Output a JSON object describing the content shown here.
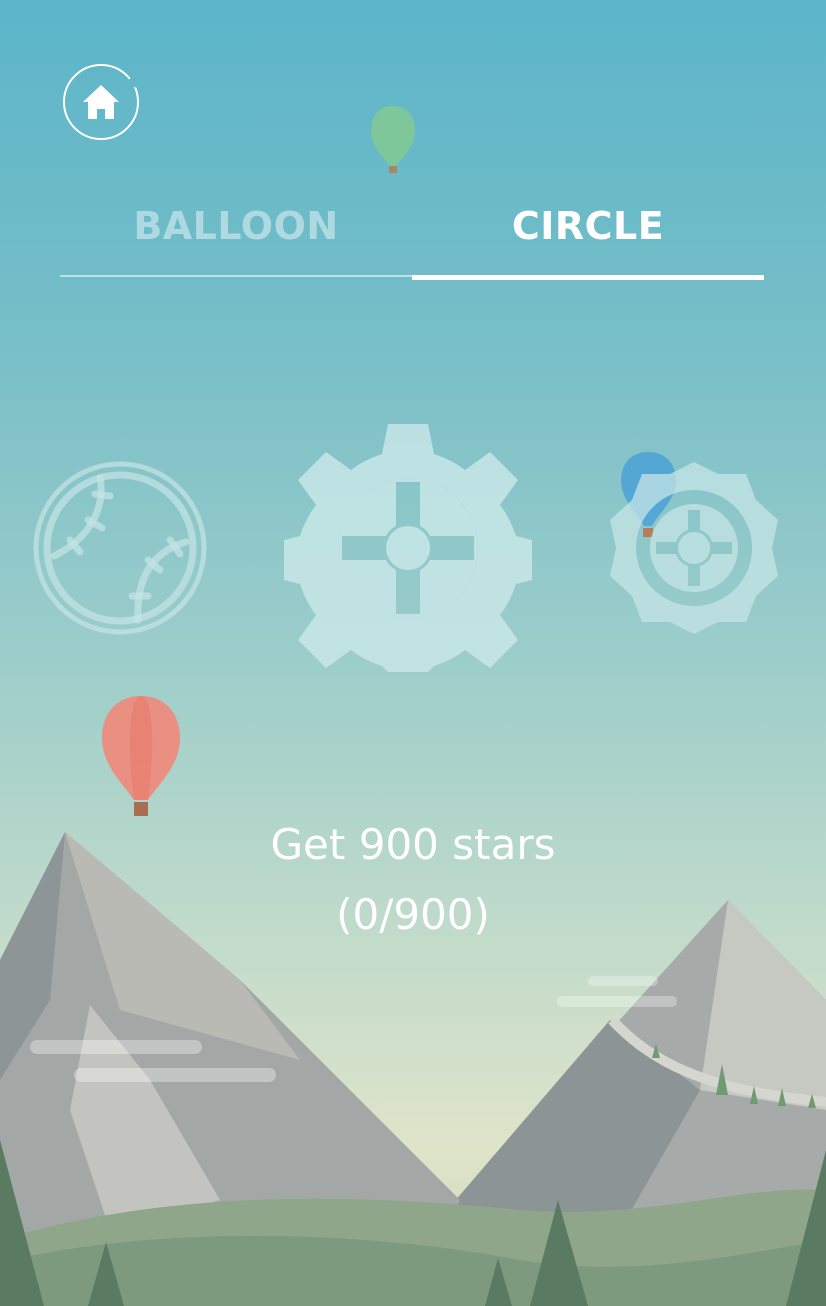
{
  "nav": {
    "home_icon": "home-icon"
  },
  "tabs": [
    {
      "label": "BALLOON",
      "active": false
    },
    {
      "label": "CIRCLE",
      "active": true
    }
  ],
  "levels": [
    {
      "icon": "baseball-icon",
      "state": "locked"
    },
    {
      "icon": "gear-icon",
      "state": "selected"
    },
    {
      "icon": "octagon-gear-icon",
      "state": "locked"
    }
  ],
  "unlock": {
    "requirement": "Get 900 stars",
    "progress": "(0/900)",
    "stars_have": 0,
    "stars_needed": 900
  },
  "colors": {
    "sky_top": "#5bb5c9",
    "sky_bottom": "#dfe4c9",
    "icon_fill": "#c6e4e6",
    "balloon_green": "#7ec79a",
    "balloon_blue": "#4fa3d6",
    "balloon_red": "#ef8a7c"
  }
}
